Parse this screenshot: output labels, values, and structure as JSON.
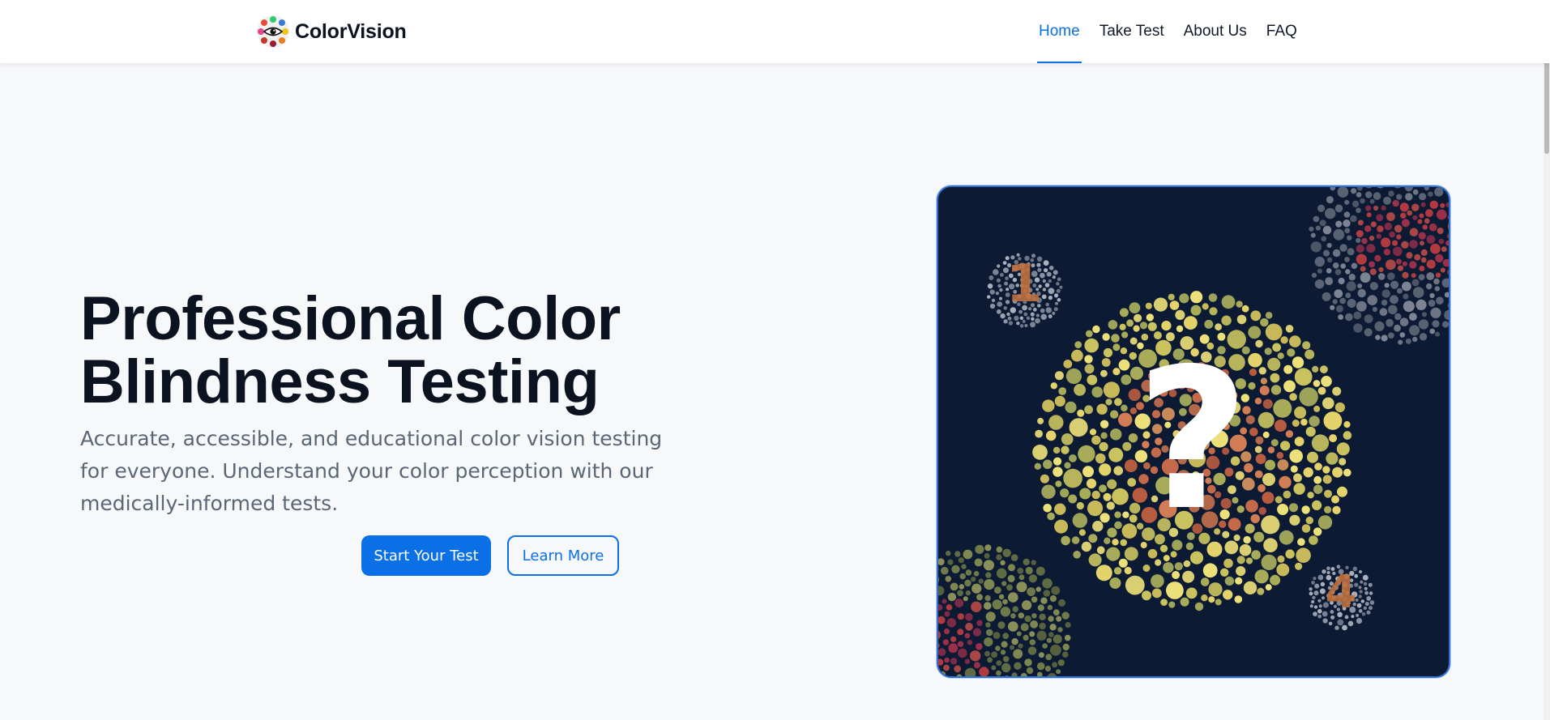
{
  "brand": {
    "name": "ColorVision",
    "logo_icon": "eye-palette-icon"
  },
  "nav": {
    "items": [
      {
        "label": "Home",
        "active": true
      },
      {
        "label": "Take Test",
        "active": false
      },
      {
        "label": "About Us",
        "active": false
      },
      {
        "label": "FAQ",
        "active": false
      }
    ]
  },
  "hero": {
    "title": "Professional Color Blindness Testing",
    "subtitle": "Accurate, accessible, and educational color vision testing for everyone. Understand your color perception with our medically-informed tests.",
    "primary_button": "Start Your Test",
    "secondary_button": "Learn More",
    "image": {
      "main_plate_symbol": "?",
      "small_plate_top_left": "1",
      "small_plate_bottom_right": "4"
    }
  },
  "colors": {
    "accent": "#0b6fe6",
    "title": "#0b1220",
    "subtitle": "#5b6677",
    "page_bg": "#f7f8fa",
    "image_bg": "#0c1a33"
  }
}
